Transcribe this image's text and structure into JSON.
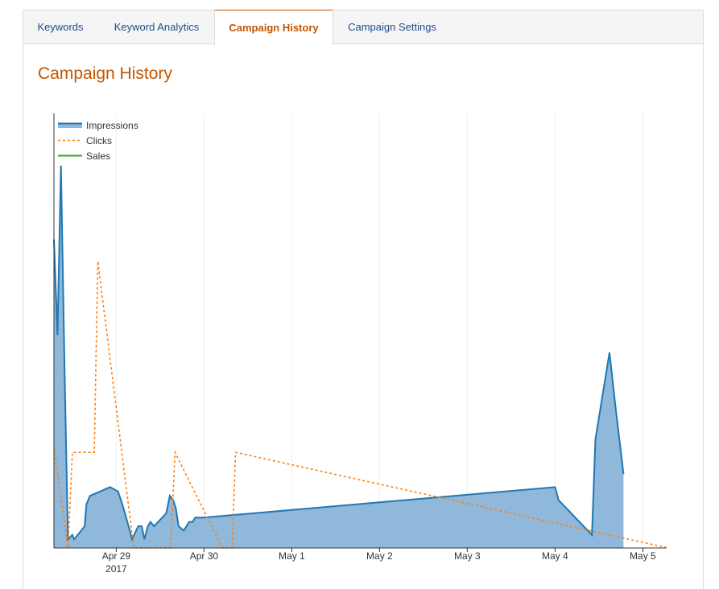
{
  "tabs": [
    {
      "label": "Keywords",
      "active": false
    },
    {
      "label": "Keyword Analytics",
      "active": false
    },
    {
      "label": "Campaign History",
      "active": true
    },
    {
      "label": "Campaign Settings",
      "active": false
    }
  ],
  "page_title": "Campaign History",
  "colors": {
    "accent": "#c45500",
    "link": "#1f4e8c",
    "impressions_fill": "#8fb8db",
    "impressions_line": "#1f77b4",
    "clicks": "#ff7f0e",
    "sales": "#2ca02c"
  },
  "chart_data": {
    "type": "area",
    "legend": [
      "Impressions",
      "Clicks",
      "Sales"
    ],
    "legend_position": "top-left",
    "xlabel": "",
    "ylabel": "",
    "x_ticks": [
      {
        "t": 28.0,
        "label": "Apr 29",
        "sub": "2017"
      },
      {
        "t": 29.0,
        "label": "Apr 30",
        "sub": ""
      },
      {
        "t": 30.0,
        "label": "May 1",
        "sub": ""
      },
      {
        "t": 31.0,
        "label": "May 2",
        "sub": ""
      },
      {
        "t": 32.0,
        "label": "May 3",
        "sub": ""
      },
      {
        "t": 33.0,
        "label": "May 4",
        "sub": ""
      },
      {
        "t": 34.0,
        "label": "May 5",
        "sub": ""
      }
    ],
    "xlim": [
      27.29,
      34.29
    ],
    "ylim": [
      0,
      100
    ],
    "grid": true,
    "y_ticks_shown": false,
    "series": [
      {
        "name": "Impressions",
        "kind": "area",
        "x": [
          27.29,
          27.33,
          27.37,
          27.41,
          27.45,
          27.5,
          27.52,
          27.64,
          27.66,
          27.7,
          27.93,
          28.02,
          28.07,
          28.14,
          28.18,
          28.25,
          28.29,
          28.32,
          28.36,
          28.39,
          28.43,
          28.57,
          28.61,
          28.65,
          28.68,
          28.71,
          28.77,
          28.8,
          28.83,
          28.87,
          28.9,
          28.96,
          29.0,
          33.0,
          33.04,
          33.42,
          33.46,
          33.62,
          33.68,
          33.78
        ],
        "y": [
          71,
          49,
          88,
          42,
          2,
          3,
          2,
          5,
          10,
          12,
          14,
          13,
          10,
          5,
          2,
          5,
          5,
          2,
          5,
          6,
          5,
          8,
          12,
          11,
          9,
          5,
          4,
          5,
          6,
          6,
          7,
          7,
          7,
          14,
          11,
          3,
          25,
          45,
          34,
          17
        ]
      },
      {
        "name": "Clicks",
        "kind": "line",
        "x": [
          27.29,
          27.45,
          27.5,
          27.75,
          27.79,
          28.2,
          28.62,
          28.67,
          29.21,
          29.32,
          29.36,
          34.29
        ],
        "y": [
          23,
          0,
          22,
          22,
          66,
          0,
          0,
          22,
          0,
          0,
          22,
          0
        ]
      },
      {
        "name": "Sales",
        "kind": "line",
        "x": [],
        "y": []
      }
    ]
  }
}
